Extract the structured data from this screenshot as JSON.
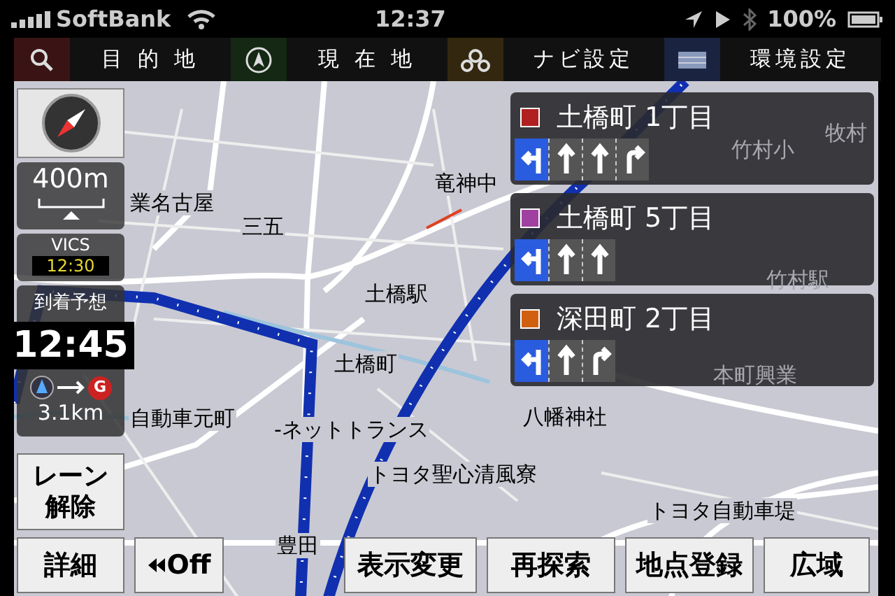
{
  "status_bar": {
    "carrier": "SoftBank",
    "time": "12:37",
    "battery": "100%"
  },
  "menu": [
    {
      "kind": "search",
      "label": "目 的 地"
    },
    {
      "kind": "position",
      "label": "現 在 地"
    },
    {
      "kind": "gear",
      "label": "ナビ設定"
    },
    {
      "kind": "screen",
      "label": "環境設定"
    }
  ],
  "map_labels": [
    "業名古屋",
    "三五",
    "竜神中",
    "土橋駅",
    "土橋町",
    "自動車元町",
    "-ネットトランス",
    "八幡神社",
    "トヨタ聖心清風寮",
    "トヨタ自動車堤",
    "豊田"
  ],
  "labels_behind_panels": [
    "竹村小",
    "牧村",
    "竹村駅",
    "本町興業"
  ],
  "guidance": [
    {
      "name": "土橋町 1丁目",
      "color": "#b02020",
      "lanes": [
        {
          "kind": "left",
          "highlighted": true
        },
        {
          "kind": "straight",
          "highlighted": false
        },
        {
          "kind": "straight",
          "highlighted": false
        },
        {
          "kind": "right",
          "highlighted": false
        }
      ]
    },
    {
      "name": "土橋町 5丁目",
      "color": "#a040a0",
      "lanes": [
        {
          "kind": "left",
          "highlighted": true
        },
        {
          "kind": "straight",
          "highlighted": false
        },
        {
          "kind": "straight",
          "highlighted": false
        }
      ]
    },
    {
      "name": "深田町 2丁目",
      "color": "#d06010",
      "lanes": [
        {
          "kind": "left",
          "highlighted": true
        },
        {
          "kind": "straight",
          "highlighted": false
        },
        {
          "kind": "right",
          "highlighted": false
        }
      ]
    }
  ],
  "scale": "400m",
  "vics": {
    "label": "VICS",
    "time": "12:30"
  },
  "arrival": {
    "label": "到着予想",
    "time": "12:45",
    "goal_mark": "G",
    "distance": "3.1km"
  },
  "lane_button": "レーン解除",
  "bottom_buttons": [
    {
      "kind": "plain",
      "label": "詳細"
    },
    {
      "kind": "back",
      "label": "Off"
    },
    {
      "kind": "plain",
      "label": "表示変更"
    },
    {
      "kind": "plain",
      "label": "再探索"
    },
    {
      "kind": "plain",
      "label": "地点登録"
    },
    {
      "kind": "plain",
      "label": "広域"
    }
  ]
}
